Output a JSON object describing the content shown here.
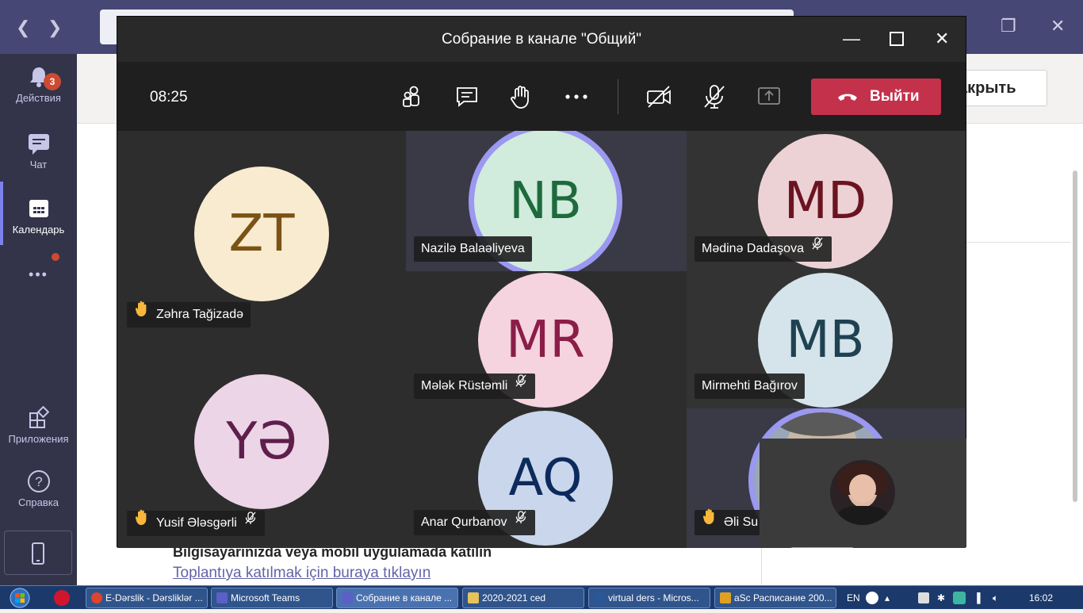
{
  "background": {
    "rail": {
      "activity_label": "Действия",
      "activity_badge": "3",
      "chat_label": "Чат",
      "calendar_label": "Календарь",
      "more_label": "•••",
      "apps_label": "Приложения",
      "help_label": "Справка"
    },
    "close_button_label": "акрыть",
    "join_title": "Bilgisayarınızda veya mobil uygulamada katılın",
    "join_link": "Toplantıya katılmak için buraya tıklayın"
  },
  "meeting": {
    "title": "Собрание в канале \"Общий\"",
    "timer": "08:25",
    "leave_label": "Выйти",
    "toolbar_icons": [
      "participants-icon",
      "chat-icon",
      "raise-hand-icon",
      "more-icon",
      "camera-off-icon",
      "mic-off-icon",
      "share-tray-icon"
    ],
    "participants": [
      {
        "initials": "ZT",
        "name": "Zəhra Tağizadə",
        "hand_raised": true,
        "muted": false,
        "bg": "#f9ebd0",
        "fg": "#7a5314"
      },
      {
        "initials": "NB",
        "name": "Nazilə Balaəliyeva",
        "hand_raised": false,
        "muted": false,
        "speaking": true,
        "bg": "#d1ebdc",
        "fg": "#1e6a3d"
      },
      {
        "initials": "MD",
        "name": "Mədinə Dadaşova",
        "hand_raised": false,
        "muted": true,
        "bg": "#edd2d5",
        "fg": "#6b1421"
      },
      {
        "initials": "MR",
        "name": "Mələk Rüstəmli",
        "hand_raised": false,
        "muted": true,
        "bg": "#f5d3df",
        "fg": "#8b1d48"
      },
      {
        "initials": "MB",
        "name": "Mirmehti Bağırov",
        "hand_raised": false,
        "muted": false,
        "bg": "#d5e3ea",
        "fg": "#1e4251"
      },
      {
        "initials": "YƏ",
        "name": "Yusif Ələsgərli",
        "hand_raised": true,
        "muted": true,
        "bg": "#ecd5e6",
        "fg": "#5e1f4c"
      },
      {
        "initials": "AQ",
        "name": "Anar Qurbanov",
        "hand_raised": false,
        "muted": true,
        "bg": "#c9d6eb",
        "fg": "#0d2a5c"
      },
      {
        "initials": "",
        "name": "Əli Su",
        "hand_raised": true,
        "muted": false,
        "speaking": true,
        "bg": "#9aa7b6",
        "fg": "#fff"
      }
    ]
  },
  "taskbar": {
    "tasks": [
      {
        "label": "E-Dərslik - Dərsliklər ...",
        "icon_color": "#e0442d"
      },
      {
        "label": "Microsoft Teams",
        "icon_color": "#5b5fc7"
      },
      {
        "label": "Собрание в канале ...",
        "icon_color": "#5b5fc7"
      },
      {
        "label": "2020-2021 ced",
        "icon_color": "#e6c35c"
      },
      {
        "label": "virtual ders - Micros...",
        "icon_color": "#2b5797"
      },
      {
        "label": "aSc Расписание 200...",
        "icon_color": "#e0a020"
      }
    ],
    "lang": "EN",
    "clock": "16:02"
  }
}
